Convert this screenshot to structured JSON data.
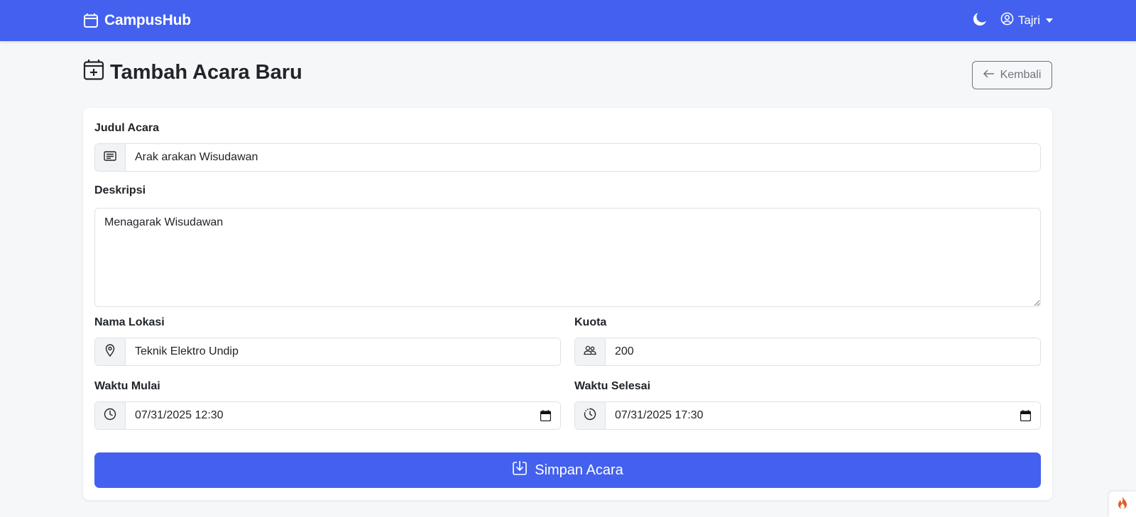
{
  "navbar": {
    "brand": "CampusHub",
    "user_name": "Tajri",
    "bg_color": "#4361ee"
  },
  "header": {
    "title": "Tambah Acara Baru",
    "back_label": "Kembali"
  },
  "form": {
    "title_label": "Judul Acara",
    "title_value": "Arak arakan Wisudawan",
    "desc_label": "Deskripsi",
    "desc_value": "Menagarak Wisudawan",
    "location_label": "Nama Lokasi",
    "location_value": "Teknik Elektro Undip",
    "quota_label": "Kuota",
    "quota_value": "200",
    "start_label": "Waktu Mulai",
    "start_value": "07/31/2025 12:30",
    "end_label": "Waktu Selesai",
    "end_value": "07/31/2025 17:30",
    "submit_label": "Simpan Acara"
  },
  "icons": {
    "brand": "calendar-icon",
    "theme": "moon-icon",
    "user": "user-circle-icon",
    "page": "calendar-plus-icon",
    "back": "arrow-left-icon",
    "title_field": "card-text-icon",
    "location": "geo-pin-icon",
    "quota": "people-icon",
    "start": "clock-icon",
    "end": "clock-history-icon",
    "calendar_picker": "calendar-picker-icon",
    "submit": "save-download-icon",
    "badge": "fire-icon"
  },
  "colors": {
    "accent": "#4361ee",
    "background": "#f6f7f9",
    "secondary": "#6c757d"
  }
}
